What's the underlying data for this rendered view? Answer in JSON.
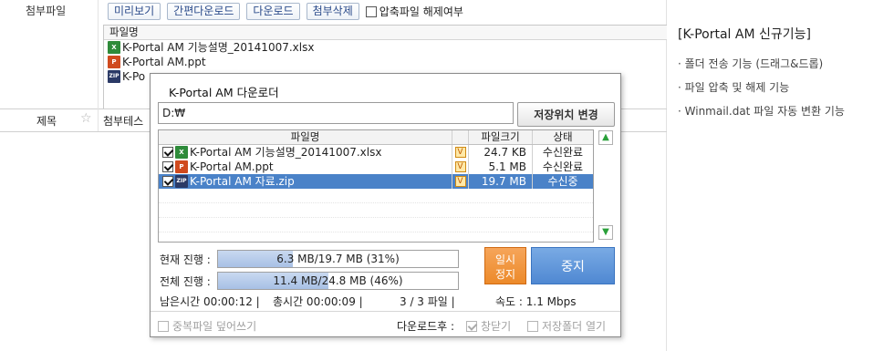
{
  "form": {
    "attach_label": "첨부파일",
    "buttons": {
      "preview": "미리보기",
      "easy_download": "간편다운로드",
      "download": "다운로드",
      "delete_attach": "첨부삭제"
    },
    "unzip_label": "압축파일 해제여부",
    "list_header": "파일명",
    "files": [
      {
        "icon": "xlsx",
        "name": "K-Portal AM 기능설명_20141007.xlsx"
      },
      {
        "icon": "ppt",
        "name": "K-Portal AM.ppt"
      },
      {
        "icon": "zip",
        "name": "K-Po"
      }
    ],
    "subject_label": "제목",
    "subject_value": "첨부테스"
  },
  "features": {
    "title": "[K-Portal AM 신규기능]",
    "items": [
      "· 폴더 전송 기능 (드래그&드롭)",
      "· 파일 압축 및 해제 기능",
      "· Winmail.dat 파일 자동 변환 기능"
    ]
  },
  "dialog": {
    "title": "K-Portal AM 다운로더",
    "path": "D:₩",
    "change_path_button": "저장위치 변경",
    "columns": {
      "name": "파일명",
      "size": "파일크기",
      "status": "상태"
    },
    "rows": [
      {
        "icon": "xlsx",
        "name": "K-Portal AM 기능설명_20141007.xlsx",
        "size": "24.7 KB",
        "status": "수신완료",
        "selected": false
      },
      {
        "icon": "ppt",
        "name": "K-Portal AM.ppt",
        "size": "5.1 MB",
        "status": "수신완료",
        "selected": false
      },
      {
        "icon": "zip",
        "name": "K-Portal AM 자료.zip",
        "size": "19.7 MB",
        "status": "수신중",
        "selected": true
      }
    ],
    "current_label": "현재 진행 :",
    "current_text": "6.3 MB/19.7 MB (31%)",
    "current_fraction": 0.31,
    "total_label": "전체 진행 :",
    "total_text": "11.4 MB/24.8 MB (46%)",
    "total_fraction": 0.46,
    "pause_label_1": "일시",
    "pause_label_2": "정지",
    "stop_label": "중지",
    "remaining": "남은시간 00:00:12 |",
    "elapsed": "총시간 00:00:09 |",
    "file_count": "3 / 3 파일 |",
    "speed": "속도 : 1.1 Mbps",
    "overwrite_label": "중복파일 덮어쓰기",
    "after_download_label": "다운로드후 :",
    "close_window_label": "창닫기",
    "open_folder_label": "저장폴더 열기"
  },
  "colors": {
    "selected_row": "#4a82c8",
    "pause_button": "#ec8a2a",
    "stop_button": "#4f88d2",
    "progress_fill": "#a7c0e5",
    "scroll_arrow": "#2aa03a"
  }
}
